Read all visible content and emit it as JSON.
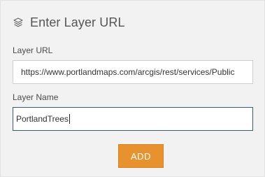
{
  "header": {
    "title": "Enter Layer URL",
    "icon": "layers-icon"
  },
  "form": {
    "layer_url": {
      "label": "Layer URL",
      "value": "https://www.portlandmaps.com/arcgis/rest/services/Public"
    },
    "layer_name": {
      "label": "Layer Name",
      "value": "PortlandTrees"
    },
    "add_button_label": "ADD"
  },
  "colors": {
    "panel_background": "#f2f2f2",
    "button_orange": "#e8922f",
    "focused_border": "#3b5a7a"
  }
}
